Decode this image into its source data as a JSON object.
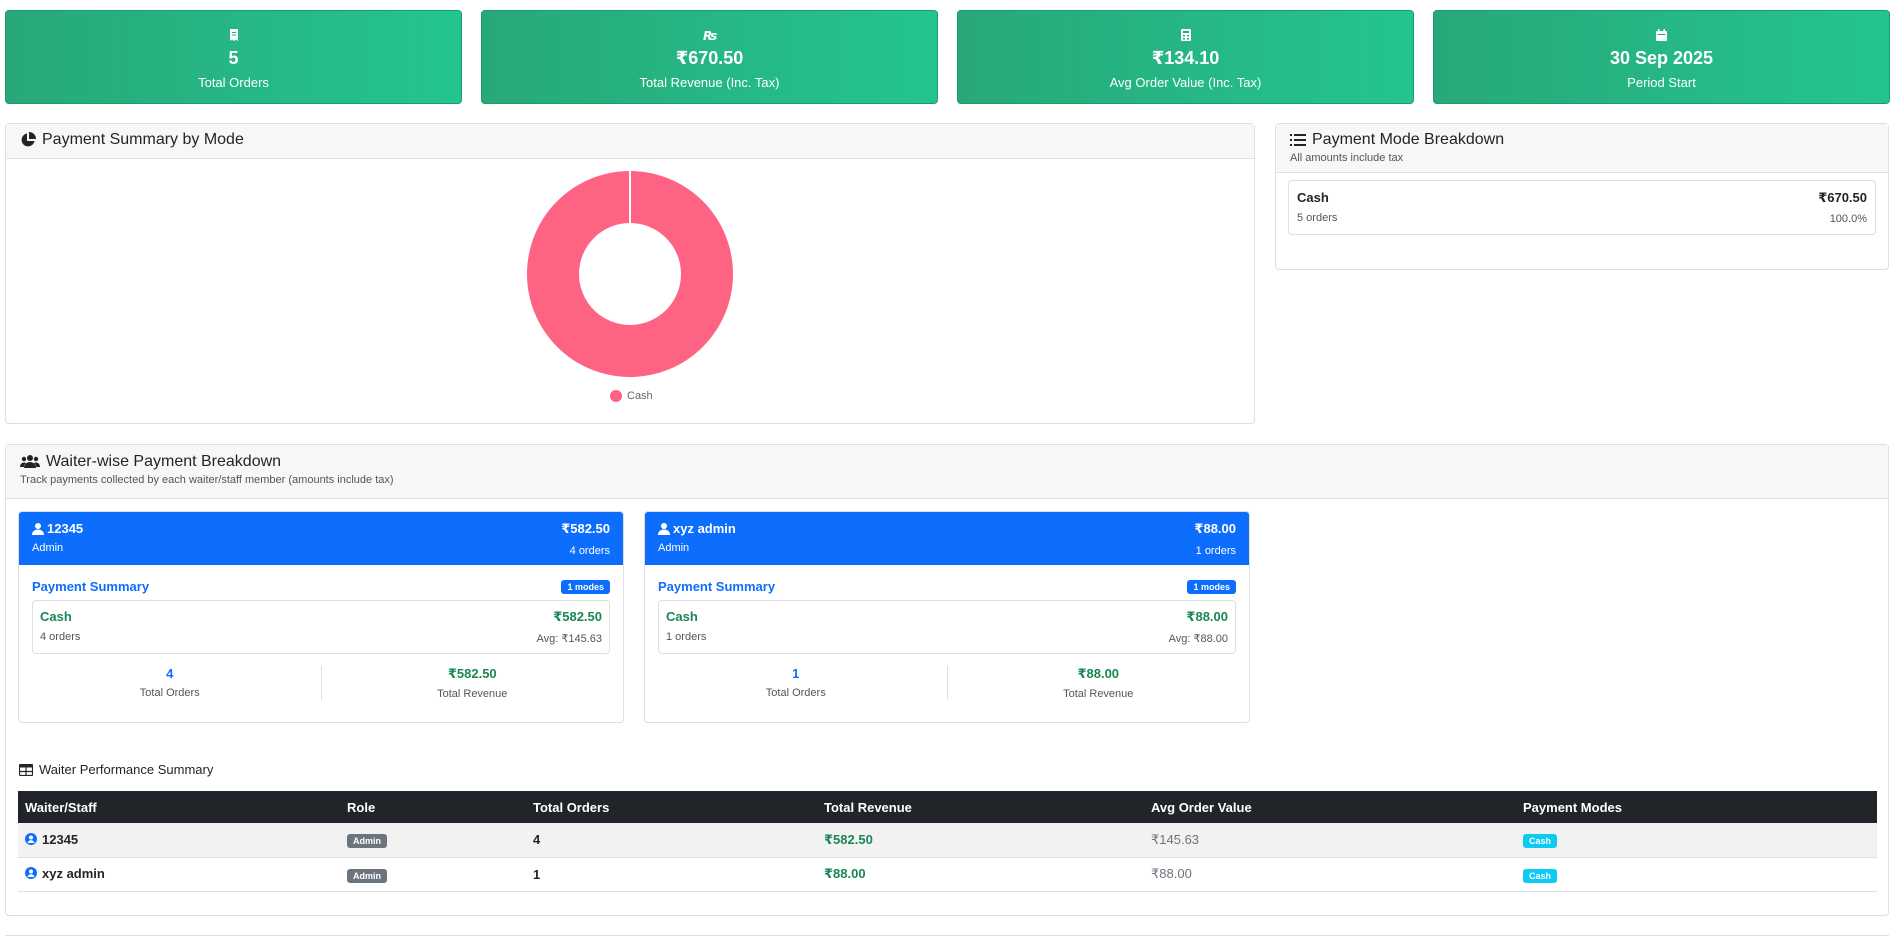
{
  "stats": [
    {
      "icon": "receipt-icon",
      "value": "5",
      "label": "Total Orders"
    },
    {
      "icon": "rupee-icon",
      "value": "₹670.50",
      "label": "Total Revenue (Inc. Tax)"
    },
    {
      "icon": "calculator-icon",
      "value": "₹134.10",
      "label": "Avg Order Value (Inc. Tax)"
    },
    {
      "icon": "calendar-icon",
      "value": "30 Sep 2025",
      "label": "Period Start"
    }
  ],
  "payment_summary": {
    "title": "Payment Summary by Mode",
    "legend": "Cash"
  },
  "chart_data": {
    "type": "pie",
    "categories": [
      "Cash"
    ],
    "values": [
      670.5
    ],
    "colors": [
      "#ff6384"
    ],
    "legend_position": "bottom"
  },
  "breakdown": {
    "title": "Payment Mode Breakdown",
    "subtitle": "All amounts include tax",
    "items": [
      {
        "mode": "Cash",
        "orders": "5 orders",
        "amount": "₹670.50",
        "percent": "100.0%"
      }
    ]
  },
  "waiter_section": {
    "title": "Waiter-wise Payment Breakdown",
    "subtitle": "Track payments collected by each waiter/staff member (amounts include tax)",
    "payment_summary_label": "Payment Summary",
    "total_orders_label": "Total Orders",
    "total_revenue_label": "Total Revenue",
    "waiters": [
      {
        "name": "12345",
        "role": "Admin",
        "amount": "₹582.50",
        "orders": "4 orders",
        "modes_badge": "1 modes",
        "mode": "Cash",
        "mode_orders": "4 orders",
        "mode_amount": "₹582.50",
        "mode_avg": "Avg: ₹145.63",
        "total_orders": "4",
        "total_revenue": "₹582.50"
      },
      {
        "name": "xyz admin",
        "role": "Admin",
        "amount": "₹88.00",
        "orders": "1 orders",
        "modes_badge": "1 modes",
        "mode": "Cash",
        "mode_orders": "1 orders",
        "mode_amount": "₹88.00",
        "mode_avg": "Avg: ₹88.00",
        "total_orders": "1",
        "total_revenue": "₹88.00"
      }
    ]
  },
  "performance": {
    "title": "Waiter Performance Summary",
    "headers": [
      "Waiter/Staff",
      "Role",
      "Total Orders",
      "Total Revenue",
      "Avg Order Value",
      "Payment Modes"
    ],
    "rows": [
      {
        "name": "12345",
        "role": "Admin",
        "orders": "4",
        "revenue": "₹582.50",
        "avg": "₹145.63",
        "modes": "Cash"
      },
      {
        "name": "xyz admin",
        "role": "Admin",
        "orders": "1",
        "revenue": "₹88.00",
        "avg": "₹88.00",
        "modes": "Cash"
      }
    ]
  },
  "colors": {
    "stat_green": "#23c58f",
    "primary": "#0d6efd",
    "success": "#198754",
    "dark": "#212529",
    "info": "#0dcaf0",
    "chart_cash": "#ff6384"
  }
}
